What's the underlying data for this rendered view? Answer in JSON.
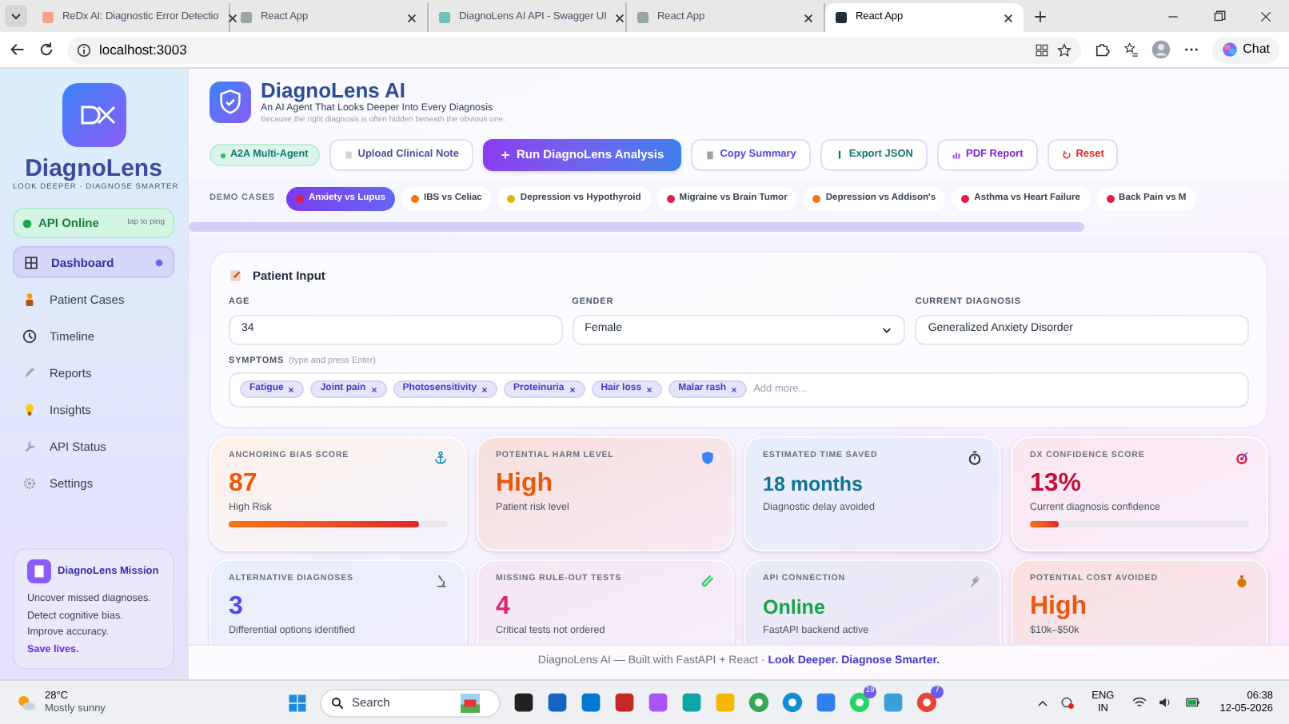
{
  "browser": {
    "tabs": [
      {
        "title": "ReDx AI: Diagnostic Error Detectio",
        "selected": false
      },
      {
        "title": "React App",
        "selected": false
      },
      {
        "title": "DiagnoLens AI API - Swagger UI",
        "selected": false
      },
      {
        "title": "React App",
        "selected": false
      },
      {
        "title": "React App",
        "selected": true
      }
    ],
    "address": "localhost:3003",
    "chat_button": "Chat"
  },
  "sidebar": {
    "brand": "DiagnoLens",
    "tagline": "LOOK DEEPER · DIAGNOSE SMARTER",
    "api_status": {
      "label": "API Online",
      "hint": "tap to ping"
    },
    "nav": [
      {
        "label": "Dashboard",
        "selected": true
      },
      {
        "label": "Patient Cases",
        "selected": false
      },
      {
        "label": "Timeline",
        "selected": false
      },
      {
        "label": "Reports",
        "selected": false
      },
      {
        "label": "Insights",
        "selected": false
      },
      {
        "label": "API Status",
        "selected": false
      },
      {
        "label": "Settings",
        "selected": false
      }
    ],
    "mission": {
      "title": "DiagnoLens Mission",
      "text": "Uncover missed diagnoses.\nDetect cognitive bias.\nImprove accuracy.\n**Save lives.**"
    }
  },
  "header": {
    "title": "DiagnoLens AI",
    "tagline": "An AI Agent That Looks Deeper Into Every Diagnosis",
    "subtitle": "Because the right diagnosis is often hidden beneath the obvious one."
  },
  "actions": [
    {
      "kind": "badge",
      "label": "A2A Multi-Agent",
      "color": "#0f766e"
    },
    {
      "kind": "outline",
      "label": "Upload Clinical Note",
      "color": "#4b4f9c"
    },
    {
      "kind": "primary",
      "label": "Run DiagnoLens Analysis"
    },
    {
      "kind": "outline",
      "label": "Copy Summary",
      "color": "#4f46e5"
    },
    {
      "kind": "outline",
      "label": "Export JSON",
      "color": "#0f766e"
    },
    {
      "kind": "outline",
      "label": "PDF Report",
      "color": "#7e22ce"
    },
    {
      "kind": "outline",
      "label": "Reset",
      "color": "#dc2626"
    }
  ],
  "demo_cases": {
    "label": "DEMO CASES",
    "cases": [
      {
        "label": "Anxiety vs Lupus",
        "color": "#e11d48",
        "selected": true
      },
      {
        "label": "IBS vs Celiac",
        "color": "#f97316",
        "selected": false
      },
      {
        "label": "Depression vs Hypothyroid",
        "color": "#eab308",
        "selected": false
      },
      {
        "label": "Migraine vs Brain Tumor",
        "color": "#e11d48",
        "selected": false
      },
      {
        "label": "Depression vs Addison's",
        "color": "#f97316",
        "selected": false
      },
      {
        "label": "Asthma vs Heart Failure",
        "color": "#e11d48",
        "selected": false
      },
      {
        "label": "Back Pain vs M",
        "color": "#e11d48",
        "selected": false
      }
    ]
  },
  "patient_input": {
    "title": "Patient Input",
    "age": {
      "label": "AGE",
      "value": "34"
    },
    "gender": {
      "label": "GENDER",
      "value": "Female"
    },
    "diagnosis": {
      "label": "CURRENT DIAGNOSIS",
      "value": "Generalized Anxiety Disorder"
    },
    "symptoms": {
      "label": "SYMPTOMS",
      "hint": "(type and press Enter)",
      "placeholder": "Add more...",
      "tags": [
        "Fatigue",
        "Joint pain",
        "Photosensitivity",
        "Proteinuria",
        "Hair loss",
        "Malar rash"
      ]
    }
  },
  "metrics": [
    {
      "label": "ANCHORING BIAS SCORE",
      "value": "87",
      "caption": "High Risk",
      "color": "#ea580c",
      "level": 0.87
    },
    {
      "label": "POTENTIAL HARM LEVEL",
      "value": "High",
      "caption": "Patient risk level",
      "color": "#ea580c"
    },
    {
      "label": "ESTIMATED TIME SAVED",
      "value": "18 months",
      "caption": "Diagnostic delay avoided",
      "color": "#0e7490"
    },
    {
      "label": "DX CONFIDENCE SCORE",
      "value": "13%",
      "caption": "Current diagnosis confidence",
      "color": "#be123c",
      "level": 0.13
    },
    {
      "label": "ALTERNATIVE DIAGNOSES",
      "value": "3",
      "caption": "Differential options identified",
      "color": "#4f46e5"
    },
    {
      "label": "MISSING RULE-OUT TESTS",
      "value": "4",
      "caption": "Critical tests not ordered",
      "color": "#db2777"
    },
    {
      "label": "API CONNECTION",
      "value": "Online",
      "caption": "FastAPI backend active",
      "color": "#16a34a"
    },
    {
      "label": "POTENTIAL COST AVOIDED",
      "value": "High",
      "caption": "$10k–$50k",
      "color": "#ea580c"
    }
  ],
  "footer": "DiagnoLens AI — Built with FastAPI + React · **Look Deeper. Diagnose Smarter.**",
  "taskbar": {
    "weather": {
      "temperature": "28°C",
      "condition": "Mostly sunny"
    },
    "search": {
      "placeholder": "Search"
    },
    "badges": [
      "19",
      "7"
    ],
    "language": [
      "ENG",
      "IN"
    ],
    "time": "06:38",
    "date": "12-05-2026"
  }
}
